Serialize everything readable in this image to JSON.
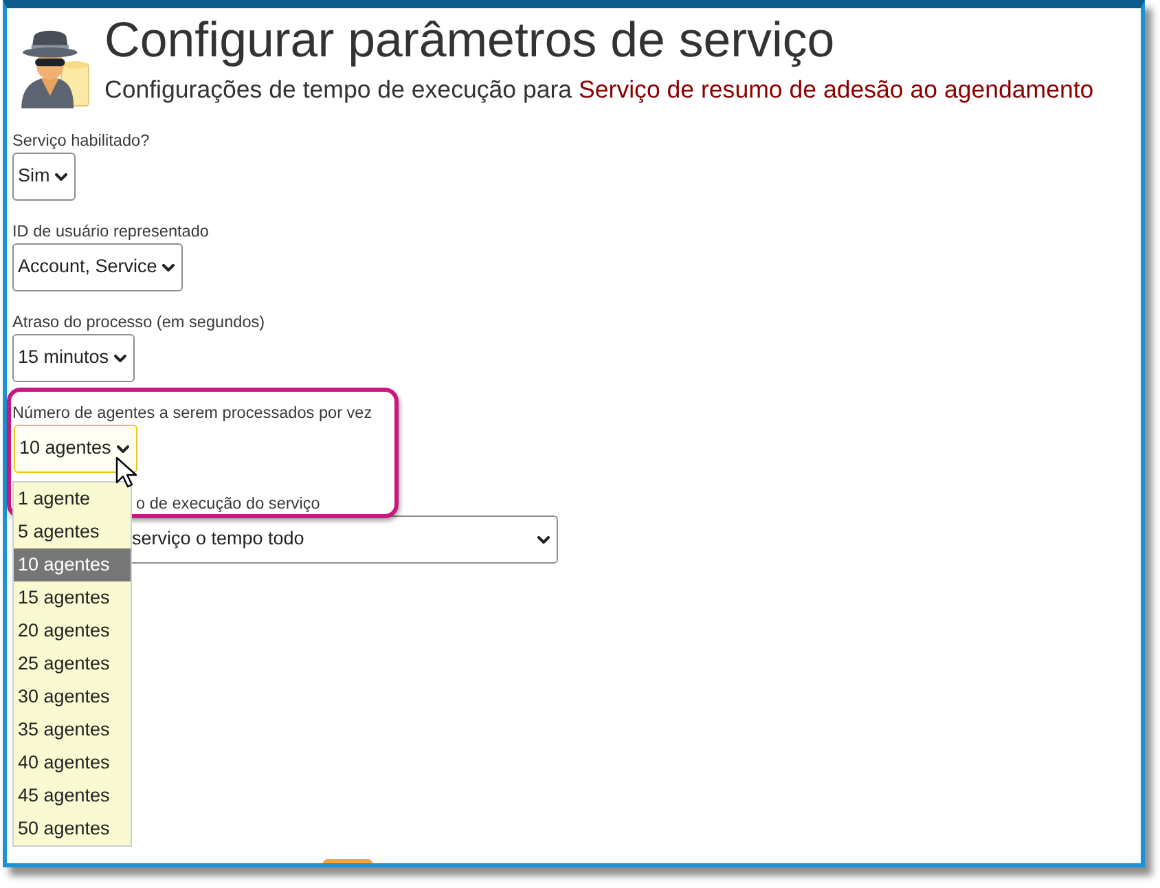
{
  "header": {
    "title": "Configurar parâmetros de serviço",
    "subtitle": "Configurações de tempo de execução para",
    "service_name": "Serviço de resumo de adesão ao agendamento"
  },
  "fields": [
    {
      "label": "Serviço habilitado?",
      "value": "Sim",
      "focused": false,
      "annotated": false,
      "expanded": false
    },
    {
      "label": "ID de usuário representado",
      "value": "Account, Service",
      "focused": false,
      "annotated": false,
      "expanded": false
    },
    {
      "label": "Atraso do processo (em segundos)",
      "value": "15 minutos",
      "focused": false,
      "annotated": false,
      "expanded": false
    },
    {
      "label": "Número de agentes a serem processados por vez",
      "value": "10 agentes",
      "focused": true,
      "annotated": true,
      "expanded": true,
      "options": [
        {
          "label": "1 agente",
          "selected": false
        },
        {
          "label": "5 agentes",
          "selected": false
        },
        {
          "label": "10 agentes",
          "selected": true
        },
        {
          "label": "15 agentes",
          "selected": false
        },
        {
          "label": "20 agentes",
          "selected": false
        },
        {
          "label": "25 agentes",
          "selected": false
        },
        {
          "label": "30 agentes",
          "selected": false
        },
        {
          "label": "35 agentes",
          "selected": false
        },
        {
          "label": "40 agentes",
          "selected": false
        },
        {
          "label": "45 agentes",
          "selected": false
        },
        {
          "label": "50 agentes",
          "selected": false
        }
      ]
    },
    {
      "label": "o de execução do serviço",
      "value": "serviço o tempo todo",
      "focused": false,
      "annotated": false,
      "expanded": false
    }
  ]
}
